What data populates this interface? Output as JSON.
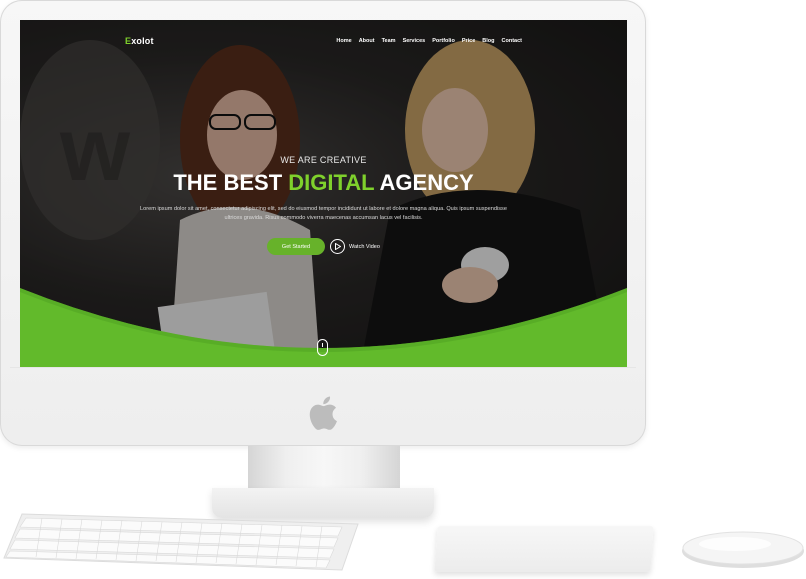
{
  "site": {
    "logo_accent": "E",
    "logo_rest": "xolot"
  },
  "nav": {
    "items": [
      "Home",
      "About",
      "Team",
      "Services",
      "Portfolio",
      "Price",
      "Blog",
      "Contact"
    ]
  },
  "hero": {
    "kicker": "WE ARE CREATIVE",
    "title_part1": "THE BEST ",
    "title_highlight": "DIGITAL",
    "title_part2": " AGENCY",
    "paragraph": "Lorem ipsum dolor sit amet, consectetur adipiscing elit, sed do eiusmod tempor incididunt ut labore et dolore magna aliqua. Quis ipsum suspendisse ultrices gravida. Risus commodo viverra maecenas accumsan lacus vel facilisis.",
    "cta_primary": "Get Started",
    "cta_secondary": "Watch Video"
  },
  "colors": {
    "accent": "#7fd12c",
    "button": "#67b22a"
  },
  "icons": {
    "brand": "apple-logo-icon",
    "play": "play-icon",
    "scroll": "mouse-scroll-icon"
  }
}
